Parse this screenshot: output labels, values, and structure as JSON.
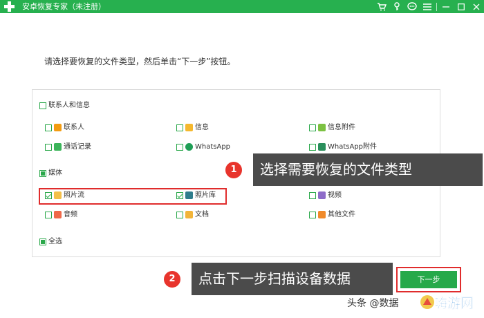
{
  "window": {
    "title": "安卓恢复专家（未注册）",
    "toolbar_icons": [
      "cart-icon",
      "key-icon",
      "chat-icon",
      "menu-icon",
      "minimize-icon",
      "maximize-icon",
      "close-icon"
    ]
  },
  "instruction": "请选择要恢复的文件类型，然后单击“下一步”按钮。",
  "groups": {
    "contacts_messages": {
      "label": "联系人和信息",
      "state": "unchecked",
      "items": {
        "contacts": {
          "label": "联系人",
          "checked": false,
          "icon": "contacts-icon"
        },
        "messages": {
          "label": "信息",
          "checked": false,
          "icon": "message-icon"
        },
        "message_attachments": {
          "label": "信息附件",
          "checked": false,
          "icon": "attachment-icon"
        },
        "call_log": {
          "label": "通话记录",
          "checked": false,
          "icon": "phone-icon"
        },
        "whatsapp": {
          "label": "WhatsApp",
          "checked": false,
          "icon": "whatsapp-icon"
        },
        "whatsapp_attachments": {
          "label": "WhatsApp附件",
          "checked": false,
          "icon": "whatsapp-attachment-icon"
        }
      }
    },
    "media": {
      "label": "媒体",
      "state": "partial",
      "items": {
        "photo_stream": {
          "label": "照片流",
          "checked": true,
          "icon": "photo-stream-icon"
        },
        "photo_library": {
          "label": "照片库",
          "checked": true,
          "icon": "photo-library-icon"
        },
        "video": {
          "label": "视频",
          "checked": false,
          "icon": "video-icon"
        },
        "audio": {
          "label": "音频",
          "checked": false,
          "icon": "audio-icon"
        },
        "documents": {
          "label": "文档",
          "checked": false,
          "icon": "folder-icon"
        },
        "other_files": {
          "label": "其他文件",
          "checked": false,
          "icon": "file-icon"
        }
      }
    },
    "select_all": {
      "label": "全选",
      "state": "partial"
    }
  },
  "annotations": {
    "step1": {
      "number": "1",
      "text": "选择需要恢复的文件类型"
    },
    "step2": {
      "number": "2",
      "text": "点击下一步扫描设备数据"
    }
  },
  "next_button": {
    "label": "下一步"
  },
  "watermark": {
    "text": "头条 @数据",
    "site": "嗨游网"
  },
  "colors": {
    "brand_green": "#27b04f",
    "highlight_red": "#e02c2c",
    "annotation_bg": "#4b4b4b"
  }
}
